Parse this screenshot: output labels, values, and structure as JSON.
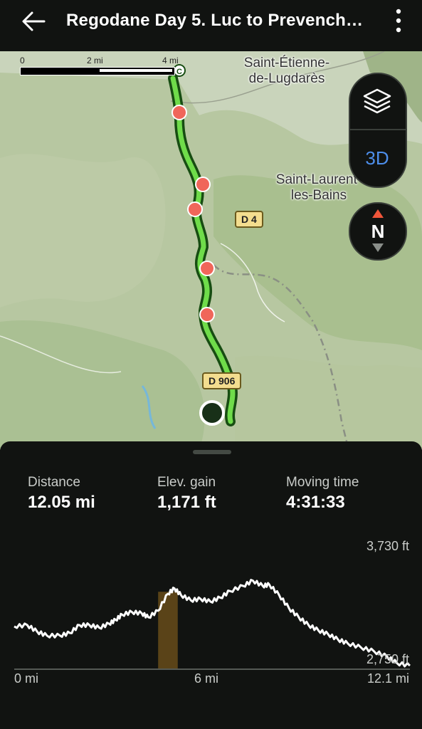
{
  "header": {
    "title": "Regodane Day 5. Luc to Prevench…",
    "back_icon": "arrow-left-icon",
    "menu_icon": "more-vertical-icon"
  },
  "map": {
    "scale": {
      "labels": [
        "0",
        "2 mi",
        "4 mi"
      ]
    },
    "places": [
      "Saint-Étienne-\nde-Lugdarès",
      "Saint-Laurent-\nles-Bains"
    ],
    "roads": [
      "D 4",
      "D 906"
    ],
    "controls": {
      "layers_icon": "layers-icon",
      "three_d_label": "3D",
      "compass_label": "N"
    },
    "colors": {
      "route": "#6fdc4a",
      "route_outline": "#174d12",
      "waypoint": "#f0665a",
      "end_marker": "#183018"
    }
  },
  "stats": [
    {
      "label": "Distance",
      "value": "12.05 mi"
    },
    {
      "label": "Elev. gain",
      "value": "1,171 ft"
    },
    {
      "label": "Moving time",
      "value": "4:31:33"
    }
  ],
  "chart_data": {
    "type": "area",
    "title": "",
    "xlabel": "",
    "ylabel": "",
    "x_unit": "mi",
    "y_unit": "ft",
    "xlim": [
      0,
      12.1
    ],
    "ylim": [
      2750,
      3730
    ],
    "x_tick_labels": [
      "0 mi",
      "6 mi",
      "12.1 mi"
    ],
    "y_tick_labels": [
      "3,730 ft",
      "2,750 ft"
    ],
    "highlight_range": [
      4.4,
      5.0
    ],
    "highlight_color": "#5a4318",
    "series": [
      {
        "x": [
          0,
          0.4,
          0.7,
          1.0,
          1.4,
          1.7,
          2.0,
          2.3,
          2.6,
          2.9,
          3.1,
          3.3,
          3.6,
          3.9,
          4.1,
          4.4,
          4.7,
          4.9,
          5.1,
          5.4,
          5.7,
          6.0,
          6.3,
          6.6,
          7.0,
          7.3,
          7.6,
          7.8,
          8.1,
          8.4,
          8.7,
          9.0,
          9.3,
          9.6,
          9.9,
          10.2,
          10.6,
          11.0,
          11.4,
          11.7,
          12.1
        ],
        "y": [
          3050,
          3060,
          3010,
          2980,
          2980,
          3000,
          3060,
          3060,
          3040,
          3070,
          3100,
          3140,
          3160,
          3150,
          3120,
          3170,
          3300,
          3340,
          3290,
          3250,
          3260,
          3240,
          3270,
          3320,
          3360,
          3400,
          3360,
          3370,
          3290,
          3190,
          3120,
          3060,
          3020,
          2990,
          2950,
          2920,
          2890,
          2860,
          2820,
          2770,
          2750
        ]
      }
    ]
  }
}
